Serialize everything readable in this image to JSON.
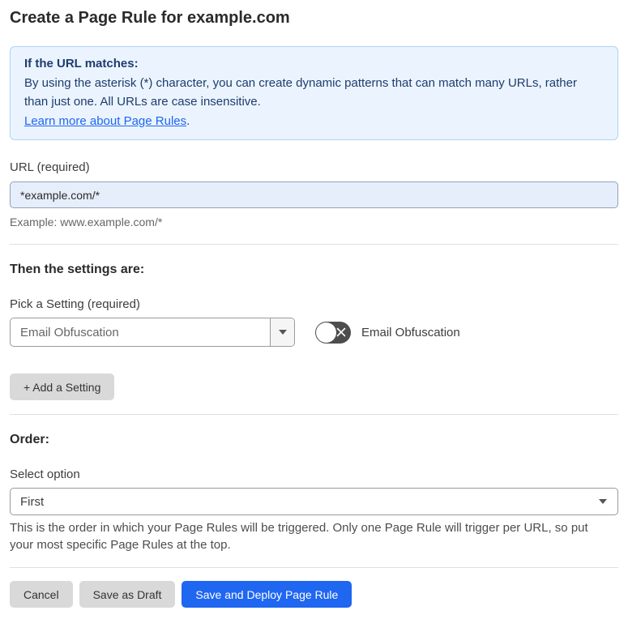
{
  "page": {
    "title": "Create a Page Rule for example.com"
  },
  "info_box": {
    "heading": "If the URL matches:",
    "body": "By using the asterisk (*) character, you can create dynamic patterns that can match many URLs, rather than just one. All URLs are case insensitive.",
    "link_text": "Learn more about Page Rules",
    "link_suffix": "."
  },
  "url_field": {
    "label": "URL (required)",
    "value": "*example.com/*",
    "hint": "Example: www.example.com/*"
  },
  "settings_section": {
    "heading": "Then the settings are:",
    "picker_label": "Pick a Setting (required)",
    "picker_value": "Email Obfuscation",
    "toggle_state": "off",
    "toggle_label": "Email Obfuscation",
    "add_button_label": "+ Add a Setting"
  },
  "order_section": {
    "heading": "Order:",
    "select_label": "Select option",
    "select_value": "First",
    "hint": "This is the order in which your Page Rules will be triggered. Only one Page Rule will trigger per URL, so put your most specific Page Rules at the top."
  },
  "footer": {
    "cancel_label": "Cancel",
    "save_draft_label": "Save as Draft",
    "save_deploy_label": "Save and Deploy Page Rule"
  },
  "colors": {
    "accent_blue": "#1f66f1",
    "info_box_bg": "#ebf4fe",
    "info_box_border": "#b0d3f7",
    "info_box_text": "#1d3c6e",
    "url_input_bg": "#e7eefb",
    "toggle_off_bg": "#4d4d4d",
    "gray_button_bg": "#d9d9d9"
  },
  "icons": {
    "select_caret": "chevron-down-icon",
    "toggle_off": "x-icon"
  }
}
